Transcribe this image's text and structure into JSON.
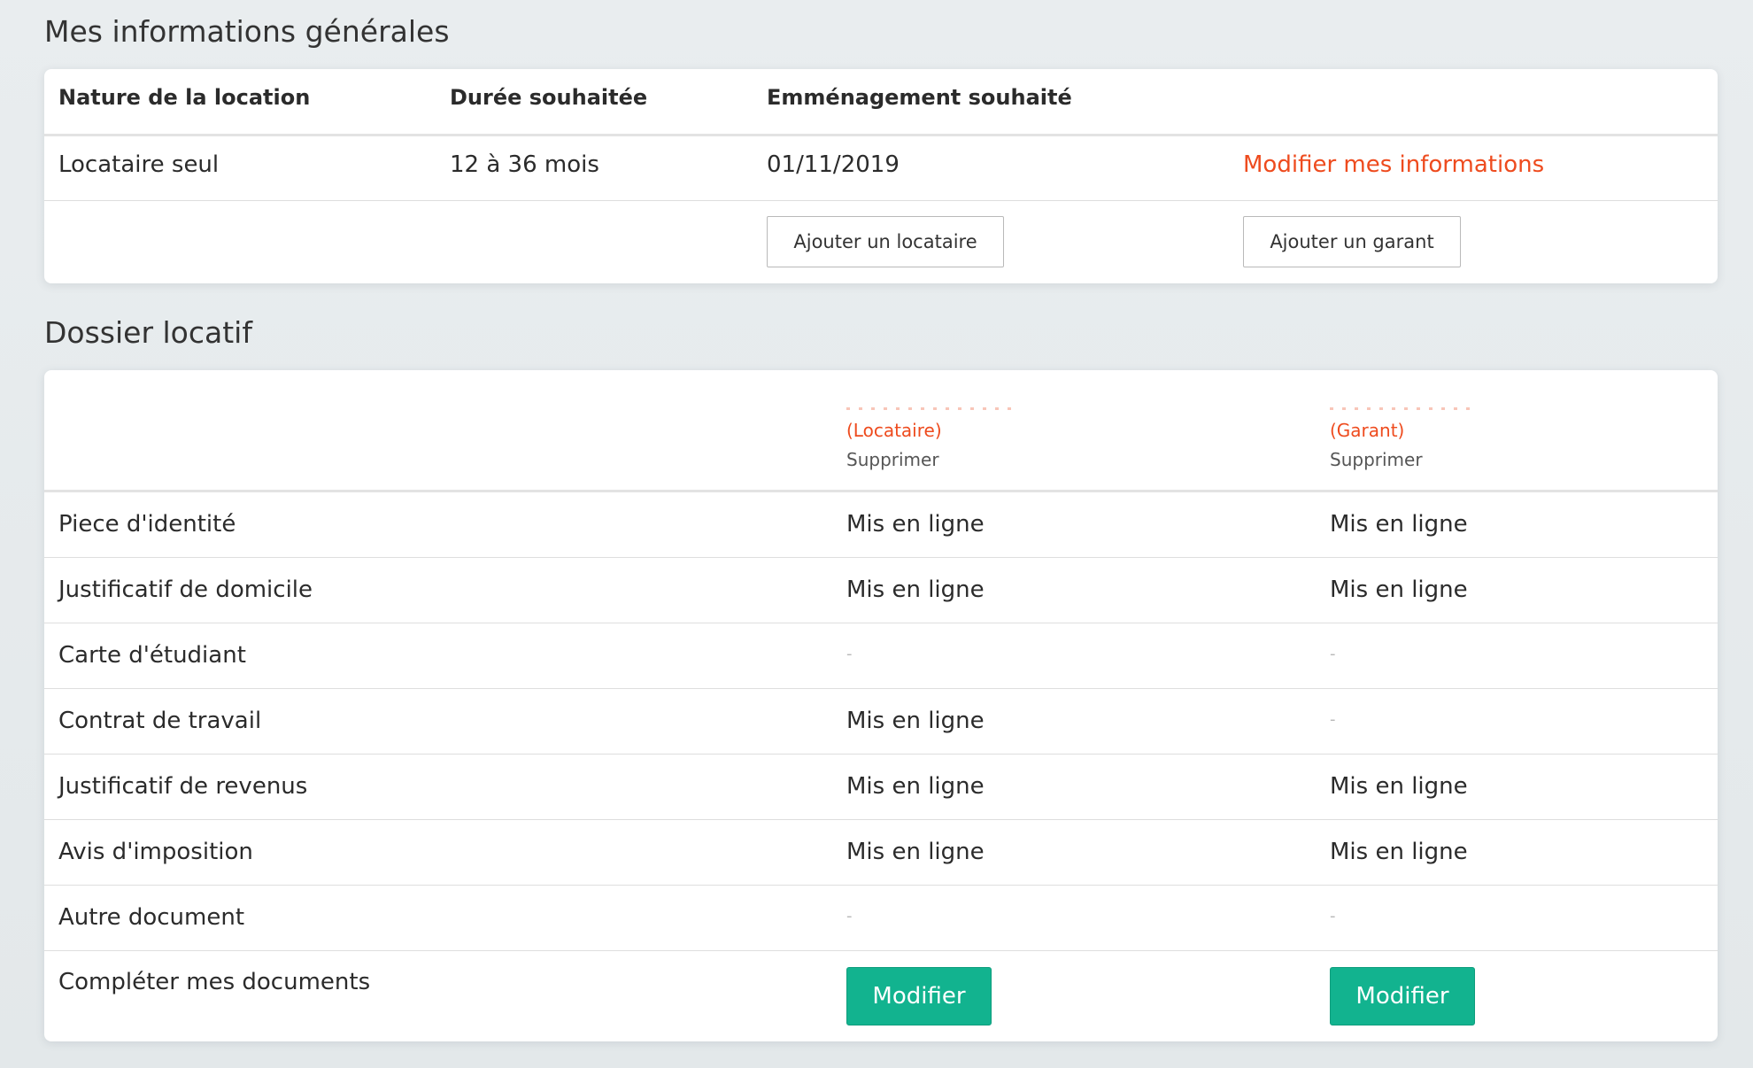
{
  "general": {
    "title": "Mes informations générales",
    "headers": {
      "nature": "Nature de la location",
      "duree": "Durée souhaitée",
      "emmenagement": "Emménagement souhaité"
    },
    "values": {
      "nature": "Locataire seul",
      "duree": "12 à 36 mois",
      "emmenagement": "01/11/2019"
    },
    "edit_link": "Modifier mes informations",
    "add_tenant_button": "Ajouter un locataire",
    "add_guarantor_button": "Ajouter un garant"
  },
  "dossier": {
    "title": "Dossier locatif",
    "persons": [
      {
        "role": "(Locataire)",
        "delete_label": "Supprimer"
      },
      {
        "role": "(Garant)",
        "delete_label": "Supprimer"
      }
    ],
    "rows": [
      {
        "label": "Piece d'identité",
        "tenant": "Mis en ligne",
        "guarantor": "Mis en ligne"
      },
      {
        "label": "Justificatif de domicile",
        "tenant": "Mis en ligne",
        "guarantor": "Mis en ligne"
      },
      {
        "label": "Carte d'étudiant",
        "tenant": "-",
        "guarantor": "-"
      },
      {
        "label": "Contrat de travail",
        "tenant": "Mis en ligne",
        "guarantor": "-"
      },
      {
        "label": "Justificatif de revenus",
        "tenant": "Mis en ligne",
        "guarantor": "Mis en ligne"
      },
      {
        "label": "Avis d'imposition",
        "tenant": "Mis en ligne",
        "guarantor": "Mis en ligne"
      },
      {
        "label": "Autre document",
        "tenant": "-",
        "guarantor": "-"
      }
    ],
    "complete_label": "Compléter mes documents",
    "modify_button": "Modifier"
  },
  "colors": {
    "accent_orange": "#ee4b1e",
    "button_green": "#12b38f",
    "background": "#e6eaec",
    "card": "#ffffff"
  }
}
